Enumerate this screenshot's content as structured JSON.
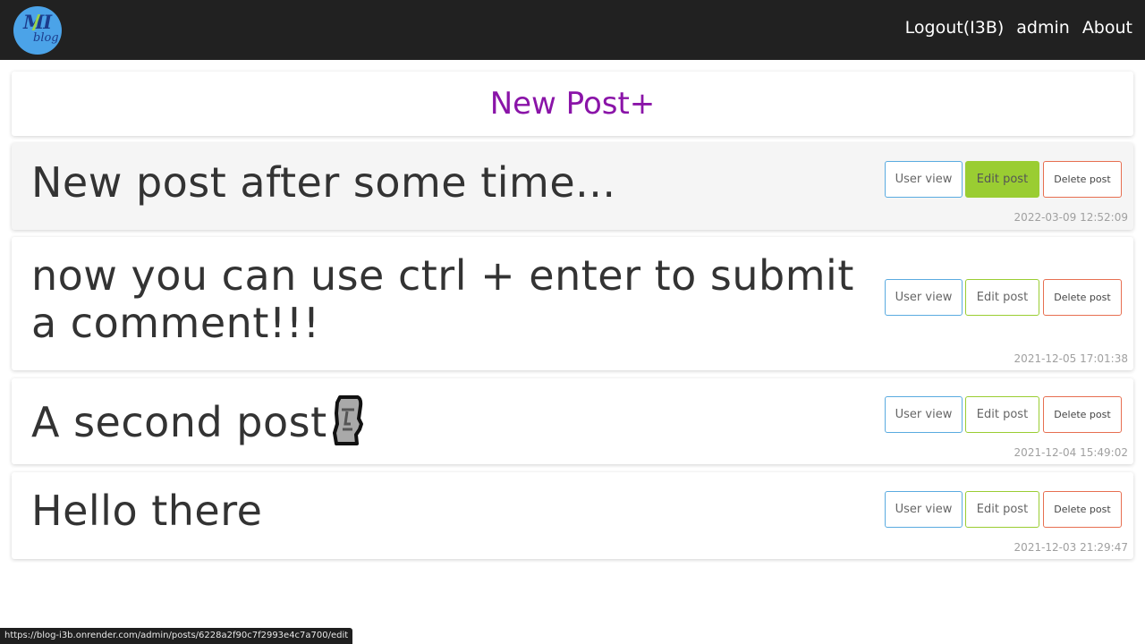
{
  "navbar": {
    "logo_text": "MI",
    "logo_subtext": "blog",
    "links": [
      "Logout(I3B)",
      "admin",
      "About"
    ]
  },
  "new_post_label": "New Post+",
  "posts": [
    {
      "title": "New post after some time...",
      "user_view_label": "User view",
      "edit_label": "Edit post",
      "delete_label": "Delete post",
      "timestamp": "2022-03-09 12:52:09",
      "highlighted": true
    },
    {
      "title": "now you can use ctrl + enter to submit",
      "title_line2": "a comment!!!",
      "user_view_label": "User view",
      "edit_label": "Edit post",
      "delete_label": "Delete post",
      "timestamp": "2021-12-05 17:01:38"
    },
    {
      "title": "A second post",
      "title_emoji": "moai-icon",
      "user_view_label": "User view",
      "edit_label": "Edit post",
      "delete_label": "Delete post",
      "timestamp": "2021-12-04 15:49:02"
    },
    {
      "title": "Hello there",
      "user_view_label": "User view",
      "edit_label": "Edit post",
      "delete_label": "Delete post",
      "timestamp": "2021-12-03 21:29:47"
    }
  ],
  "status_url": "https://blog-i3b.onrender.com/admin/posts/6228a2f90c7f2993e4c7a700/edit",
  "colors": {
    "navbar": "#212121",
    "logo": "#4ba3e8",
    "new_post": "#8a14a8",
    "user_view_border": "#5aabe0",
    "edit_border": "#9acd32",
    "delete_border": "#e76f51"
  }
}
